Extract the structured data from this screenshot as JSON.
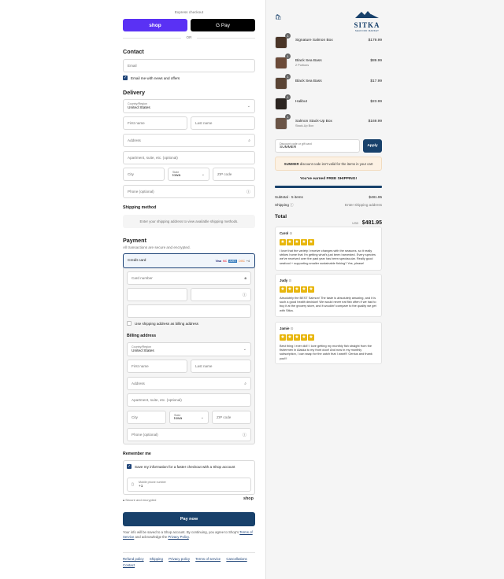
{
  "express": {
    "label": "Express checkout",
    "shop": "shop",
    "gpay": "G Pay",
    "or": "OR"
  },
  "contact": {
    "title": "Contact",
    "email_placeholder": "Email",
    "news_label": "Email me with news and offers"
  },
  "delivery": {
    "title": "Delivery",
    "country_label": "Country/Region",
    "country_value": "United States",
    "first_name": "First name",
    "last_name": "Last name",
    "address": "Address",
    "apartment": "Apartment, suite, etc. (optional)",
    "city": "City",
    "state_label": "State",
    "state_value": "Iowa",
    "zip": "ZIP code",
    "phone": "Phone (optional)"
  },
  "shipping": {
    "title": "Shipping method",
    "note": "Enter your shipping address to view available shipping methods."
  },
  "payment": {
    "title": "Payment",
    "subtitle": "All transactions are secure and encrypted.",
    "method": "Credit card",
    "cards": [
      "Visa",
      "MC",
      "AMEX",
      "DISC",
      "+4"
    ],
    "card_number": "Card number",
    "same_billing": "Use shipping address as billing address"
  },
  "billing": {
    "title": "Billing address",
    "country_label": "Country/Region",
    "country_value": "United States",
    "first_name": "First name",
    "last_name": "Last name",
    "address": "Address",
    "apartment": "Apartment, suite, etc. (optional)",
    "city": "City",
    "state_label": "State",
    "state_value": "Iowa",
    "zip": "ZIP code",
    "phone": "Phone (optional)"
  },
  "remember": {
    "title": "Remember me",
    "save_label": "Save my information for a faster checkout with a Shop account",
    "mobile_label": "Mobile phone number",
    "mobile_value": "+1",
    "secure": "Secure and encrypted",
    "shop": "shop"
  },
  "pay": {
    "button": "Pay now",
    "legal_1": "Your info will be saved to a Shop account. By continuing, you agree to Shop's",
    "terms": "Terms of Service",
    "legal_2": "and acknowledge the",
    "privacy": "Privacy Policy",
    "legal_end": "."
  },
  "footer": {
    "links": [
      "Refund policy",
      "Shipping",
      "Privacy policy",
      "Terms of service",
      "Cancellations",
      "Contact"
    ]
  },
  "brand": {
    "name": "SITKA",
    "tagline": "SEAFOOD MARKET"
  },
  "cart": {
    "items": [
      {
        "qty": "1",
        "name": "Signature Salmon Box",
        "sub": "",
        "price": "$179.99"
      },
      {
        "qty": "1",
        "name": "Black Sea Bass",
        "sub": "2 Portions",
        "price": "$89.99"
      },
      {
        "qty": "1",
        "name": "Black Sea Bass",
        "sub": "",
        "price": "$17.99"
      },
      {
        "qty": "1",
        "name": "Halibut",
        "sub": "",
        "price": "$23.99"
      },
      {
        "qty": "1",
        "name": "Salmon Stack-Up Box",
        "sub": "Stack-Up Box",
        "price": "$169.99"
      }
    ],
    "discount_label": "Discount code or gift card",
    "discount_value": "SUMMER",
    "apply": "Apply",
    "discount_code": "SUMMER",
    "discount_msg": "discount code isn't valid for the items in your cart",
    "free_shipping": "You've earned FREE SHIPPING!",
    "free_progress": 1.0,
    "subtotal_label": "Subtotal · 5 items",
    "subtotal": "$481.95",
    "shipping_label": "Shipping",
    "shipping_value": "Enter shipping address",
    "total_label": "Total",
    "currency": "USD",
    "total": "$481.95"
  },
  "reviews": [
    {
      "name": "Carol",
      "text": "I love that the variety I receive changes with the seasons, so it really strikes home that I'm getting what's just been harvested. Every species we've received over the past year has been spectacular. Really good seafood + supporting smaller sustainable fishing? Yes, please!"
    },
    {
      "name": "Judy",
      "text": "Absolutely the BEST Salmon! The taste is absolutely amazing, and it is such a good health decision! We would never eat fish often if we had to buy it at the grocery store, and it wouldn't compare to the quality we get with Sitka."
    },
    {
      "name": "Jamie",
      "text": "Best thing I ever did!! I love getting my monthly fish straight from the fishermen in Alaska to my front door! And now in my monthly subscription, I can swap for the catch that I want!!! Genius and thank you!!!"
    }
  ],
  "colors": {
    "accent": "#18416b",
    "shop": "#5a31f4",
    "star": "#e8b60c"
  }
}
